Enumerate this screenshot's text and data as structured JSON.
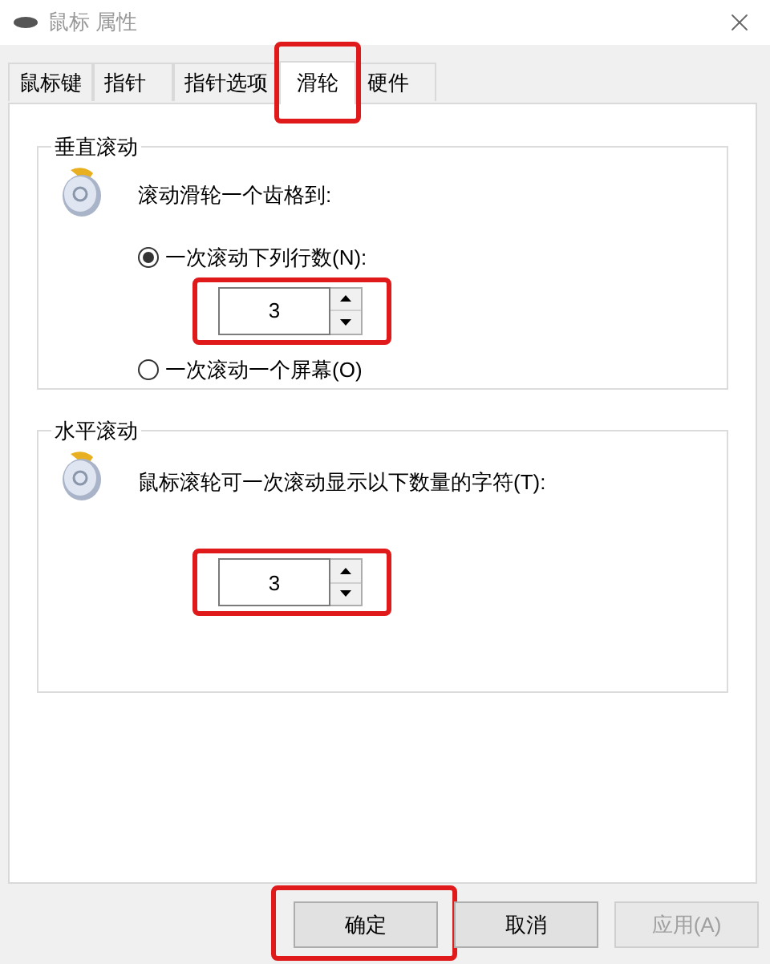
{
  "window": {
    "title": "鼠标 属性"
  },
  "tabs": [
    {
      "label": "鼠标键",
      "selected": false,
      "highlighted": false
    },
    {
      "label": "指针",
      "selected": false,
      "highlighted": false
    },
    {
      "label": "指针选项",
      "selected": false,
      "highlighted": false
    },
    {
      "label": "滑轮",
      "selected": true,
      "highlighted": true
    },
    {
      "label": "硬件",
      "selected": false,
      "highlighted": false
    }
  ],
  "vertical_scroll": {
    "title": "垂直滚动",
    "prompt": "滚动滑轮一个齿格到:",
    "options": [
      {
        "label": "一次滚动下列行数(N):",
        "selected": true
      },
      {
        "label": "一次滚动一个屏幕(O)",
        "selected": false
      }
    ],
    "lines": {
      "value": "3",
      "highlighted": true
    }
  },
  "horizontal_scroll": {
    "title": "水平滚动",
    "prompt": "鼠标滚轮可一次滚动显示以下数量的字符(T):",
    "chars": {
      "value": "3",
      "highlighted": true
    }
  },
  "buttons": [
    {
      "label": "确定",
      "disabled": false,
      "highlighted": true
    },
    {
      "label": "取消",
      "disabled": false,
      "highlighted": false
    },
    {
      "label": "应用(A)",
      "disabled": true,
      "highlighted": false
    }
  ]
}
